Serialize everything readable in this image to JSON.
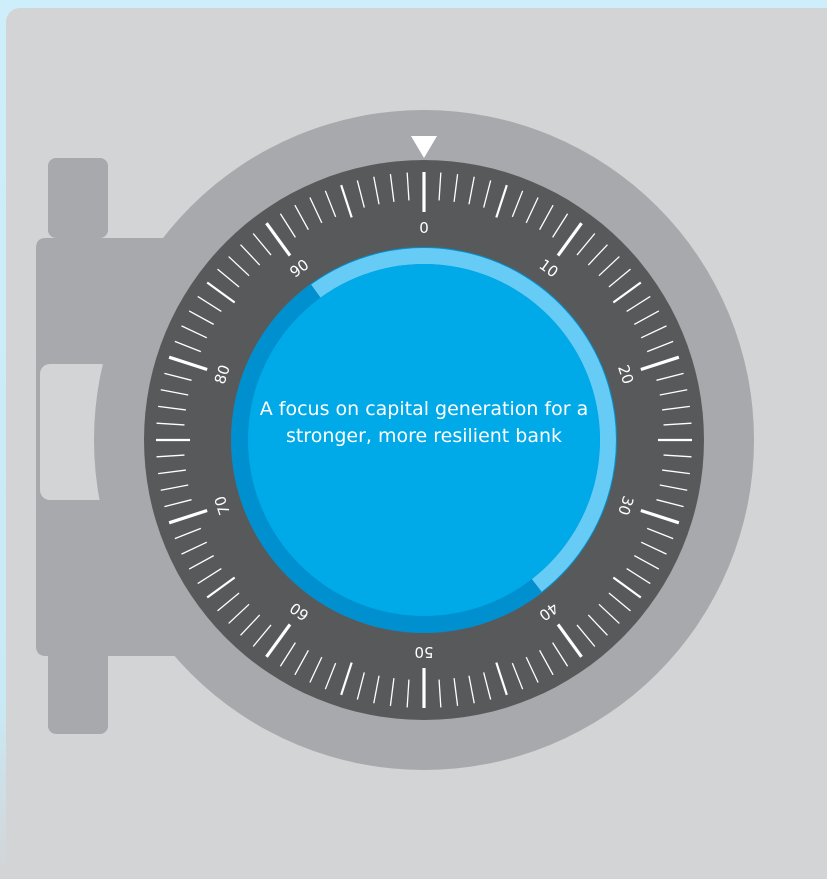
{
  "caption": "A focus on capital generation for a stronger, more resilient bank",
  "dial": {
    "labels": [
      "0",
      "10",
      "20",
      "30",
      "40",
      "50",
      "60",
      "70",
      "80",
      "90"
    ],
    "progress_arc": {
      "from_value": 90,
      "to_value": 39.5
    },
    "indicator": "down-triangle-icon"
  },
  "colors": {
    "background": "#cfeefb",
    "panel": "#d3d4d6",
    "hinge": "#a7a9ac",
    "bezel": "#a7a9ac",
    "dial_ring": "#58595b",
    "tick": "#ffffff",
    "center_dark": "#0090cf",
    "center": "#00a9e8",
    "arc_light": "#66cbf5",
    "caption_text": "#ffffff"
  }
}
